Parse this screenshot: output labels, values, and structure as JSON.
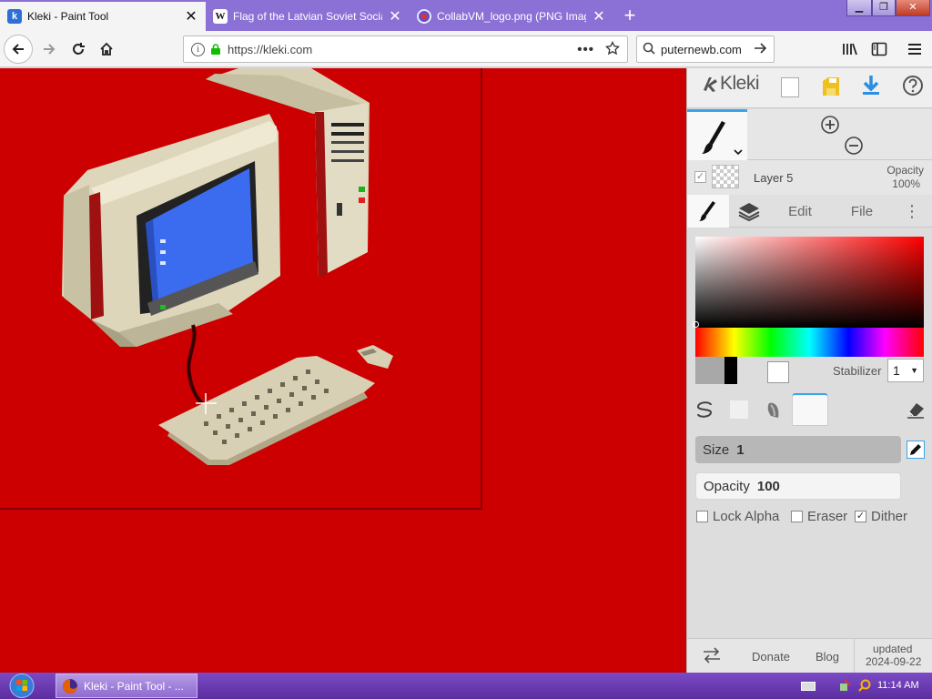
{
  "browser": {
    "tabs": [
      {
        "title": "Kleki - Paint Tool",
        "favicon": "kleki-favicon",
        "active": true
      },
      {
        "title": "Flag of the Latvian Soviet Socia",
        "favicon": "wikipedia-favicon",
        "active": false
      },
      {
        "title": "CollabVM_logo.png (PNG Imag",
        "favicon": "collabvm-favicon",
        "active": false
      }
    ],
    "url": "https://kleki.com",
    "search_text": "puternewb.com"
  },
  "app": {
    "logo_text": "Kleki",
    "layer": {
      "name": "Layer 5",
      "opacity_label": "Opacity",
      "opacity_value": "100%"
    },
    "tabs": {
      "edit": "Edit",
      "file": "File"
    },
    "stabilizer_label": "Stabilizer",
    "stabilizer_value": "1",
    "size_label": "Size",
    "size_value": "1",
    "opacity_label": "Opacity",
    "opacity_value": "100",
    "checkboxes": {
      "lock_alpha": {
        "label": "Lock Alpha",
        "checked": false
      },
      "eraser": {
        "label": "Eraser",
        "checked": false
      },
      "dither": {
        "label": "Dither",
        "checked": true
      }
    },
    "footer": {
      "donate": "Donate",
      "blog": "Blog",
      "updated_label": "updated",
      "updated_date": "2024-09-22"
    },
    "colors": {
      "canvas": "#cc0000",
      "primary": "#000000",
      "secondary": "#ffffff",
      "accent": "#3aa4e8"
    }
  },
  "taskbar": {
    "task_label": "Kleki - Paint Tool - ...",
    "time": "11:14 AM"
  }
}
